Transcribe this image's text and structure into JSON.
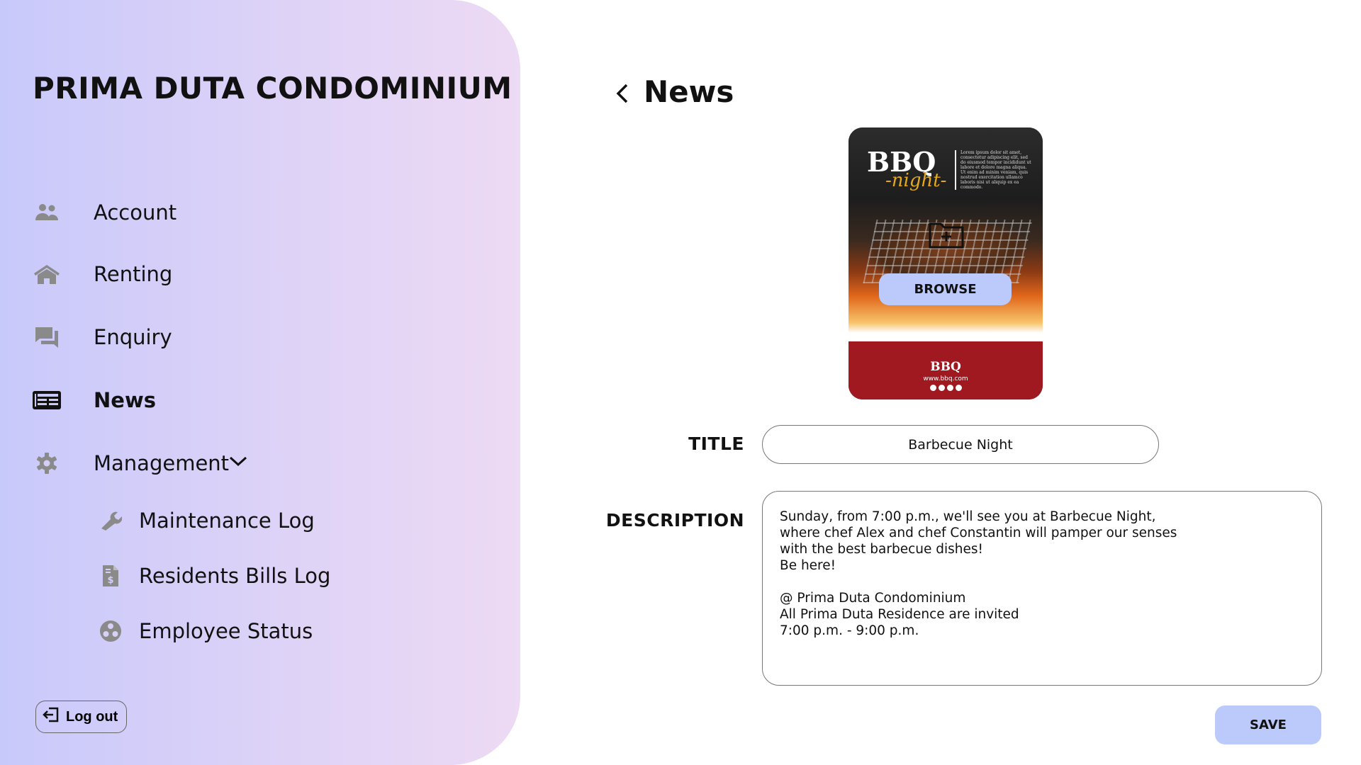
{
  "sidebar": {
    "brand": "PRIMA DUTA CONDOMINIUM",
    "items": [
      {
        "label": "Account",
        "icon": "people-icon"
      },
      {
        "label": "Renting",
        "icon": "home-icon"
      },
      {
        "label": "Enquiry",
        "icon": "chat-icon"
      },
      {
        "label": "News",
        "icon": "newspaper-icon",
        "active": true
      },
      {
        "label": "Management",
        "icon": "gear-icon",
        "expanded": true
      }
    ],
    "sub_items": [
      {
        "label": "Maintenance Log",
        "icon": "wrench-icon"
      },
      {
        "label": "Residents Bills Log",
        "icon": "bill-icon"
      },
      {
        "label": "Employee Status",
        "icon": "group-icon"
      }
    ],
    "logout_label": "Log out"
  },
  "header": {
    "title": "News"
  },
  "poster": {
    "logo": "BBQ",
    "logo_sub": "-night-",
    "blurb": "Lorem ipsum dolor sit amet, consectetur adipiscing elit, sed do eiusmod tempor incididunt ut labore et dolore magna aliqua. Ut enim ad minim veniam, quis nostrud exercitation ullamco laboris nisi ut aliquip ex ea commodo.",
    "footer_logo": "BBQ",
    "footer_url": "www.bbq.com",
    "browse_label": "BROWSE"
  },
  "form": {
    "title_label": "TITLE",
    "title_value": "Barbecue Night",
    "description_label": "DESCRIPTION",
    "description_value": "Sunday, from 7:00 p.m., we'll see you at Barbecue Night,\nwhere chef Alex and chef Constantin will pamper our senses\nwith the best barbecue dishes!\nBe here!\n\n@ Prima Duta Condominium\nAll Prima Duta Residence are invited\n7:00 p.m. - 9:00 p.m.",
    "save_label": "SAVE"
  },
  "colors": {
    "accent": "#bccafb",
    "icon_gray": "#8a8a8a",
    "poster_red": "#a01820"
  }
}
